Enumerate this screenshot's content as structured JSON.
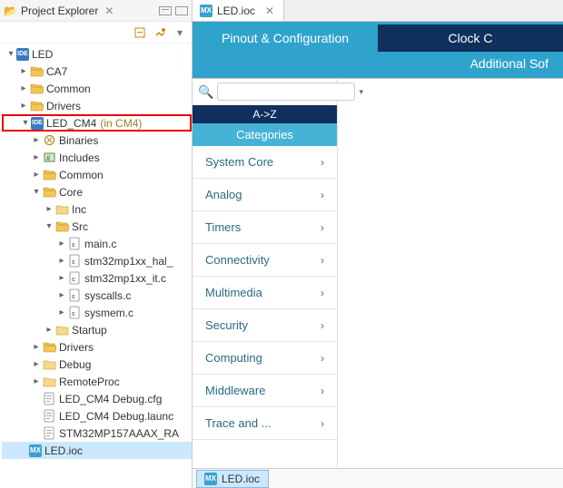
{
  "pane": {
    "title": "Project Explorer"
  },
  "tree": {
    "root": {
      "label": "LED"
    },
    "ca7": "CA7",
    "common": "Common",
    "drivers": "Drivers",
    "led_cm4": "LED_CM4",
    "led_cm4_suffix": "(in CM4)",
    "binaries": "Binaries",
    "includes": "Includes",
    "common2": "Common",
    "core": "Core",
    "inc": "Inc",
    "src": "Src",
    "main_c": "main.c",
    "hal_c": "stm32mp1xx_hal_",
    "it_c": "stm32mp1xx_it.c",
    "syscalls_c": "syscalls.c",
    "sysmem_c": "sysmem.c",
    "startup": "Startup",
    "drivers2": "Drivers",
    "debug": "Debug",
    "remoteproc": "RemoteProc",
    "dbg_cfg": "LED_CM4 Debug.cfg",
    "dbg_launch": "LED_CM4 Debug.launc",
    "rawbin": "STM32MP157AAAX_RA",
    "led_ioc": "LED.ioc"
  },
  "editor": {
    "tab": "LED.ioc"
  },
  "config": {
    "pinout_tab": "Pinout & Configuration",
    "clock_tab": "Clock C",
    "additional": "Additional Sof",
    "az": "A->Z",
    "categories": "Categories",
    "search_placeholder": ""
  },
  "categories": {
    "i0": "System Core",
    "i1": "Analog",
    "i2": "Timers",
    "i3": "Connectivity",
    "i4": "Multimedia",
    "i5": "Security",
    "i6": "Computing",
    "i7": "Middleware",
    "i8": "Trace and ..."
  },
  "bottom": {
    "tab": "LED.ioc"
  }
}
